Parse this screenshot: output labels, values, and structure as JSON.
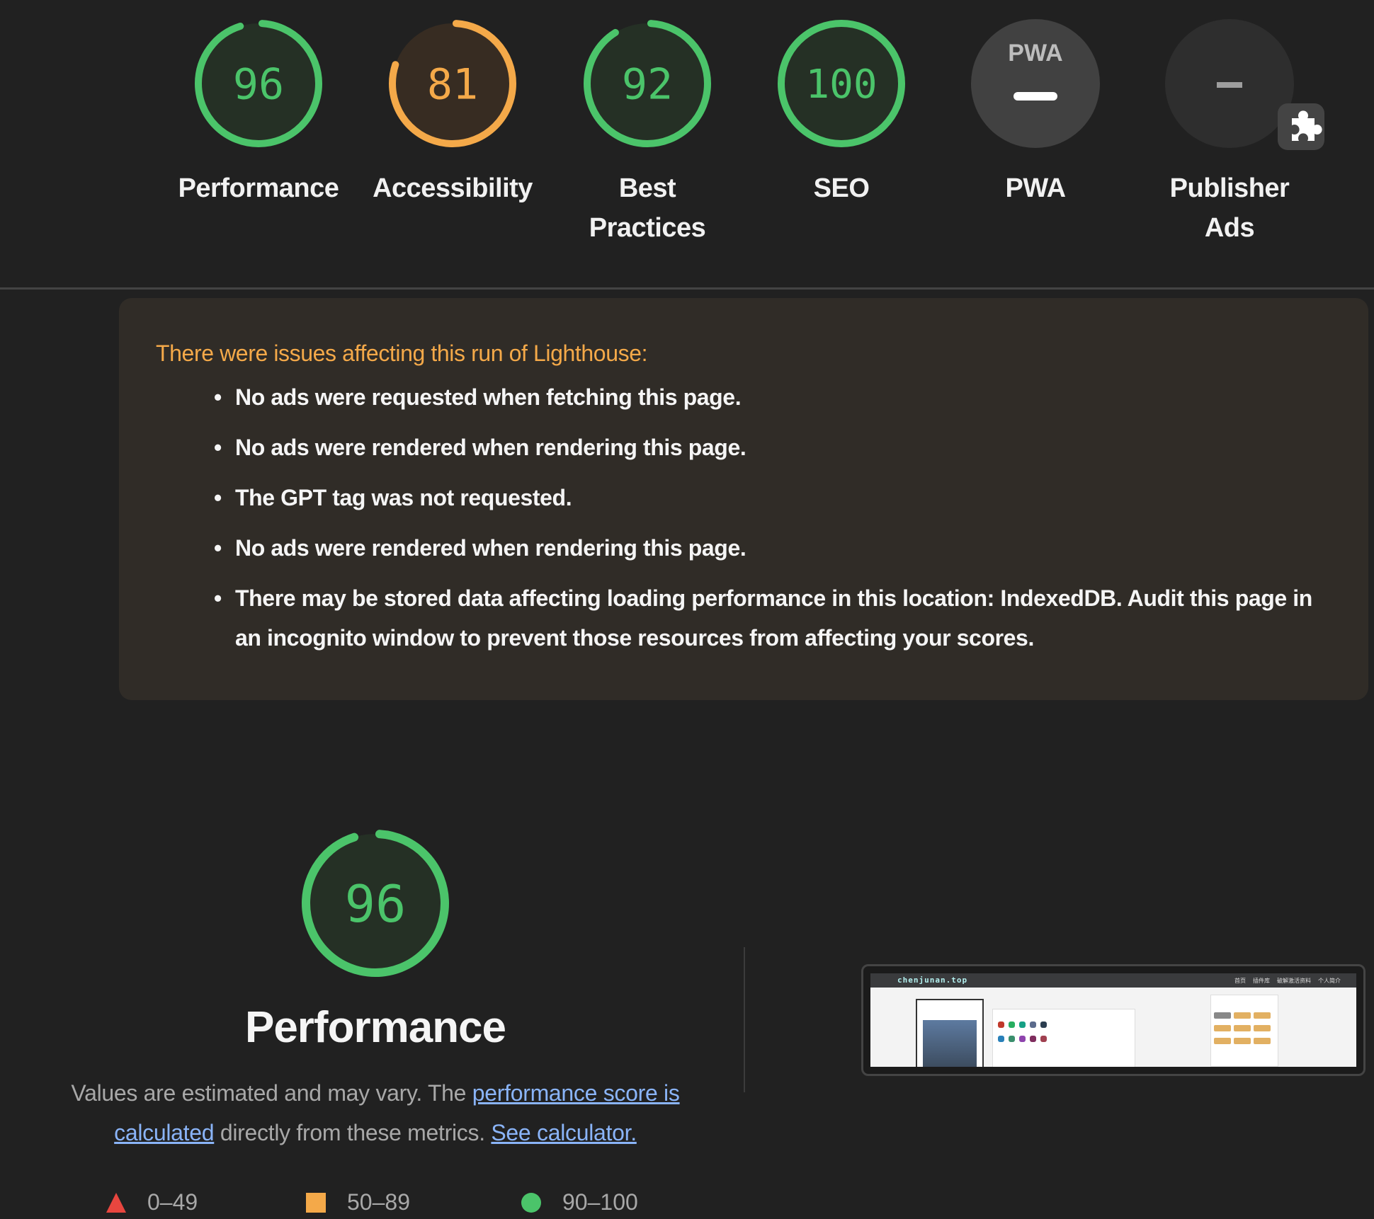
{
  "categories": [
    {
      "id": "performance",
      "score": "96",
      "label_lines": [
        "Performance"
      ],
      "type": "score",
      "color": "#4bc46a",
      "fill": "#253025",
      "fraction": 0.96
    },
    {
      "id": "accessibility",
      "score": "81",
      "label_lines": [
        "Accessibility"
      ],
      "type": "score",
      "color": "#f4a949",
      "fill": "#372c22",
      "fraction": 0.81
    },
    {
      "id": "best-practices",
      "score": "92",
      "label_lines": [
        "Best",
        "Practices"
      ],
      "type": "score",
      "color": "#4bc46a",
      "fill": "#253025",
      "fraction": 0.92
    },
    {
      "id": "seo",
      "score": "100",
      "label_lines": [
        "SEO"
      ],
      "type": "score",
      "color": "#4bc46a",
      "fill": "#253025",
      "fraction": 1.0
    },
    {
      "id": "pwa",
      "score": "–",
      "label_lines": [
        "PWA"
      ],
      "type": "pwa",
      "badge_text": "PWA"
    },
    {
      "id": "publisher-ads",
      "score": "–",
      "label_lines": [
        "Publisher",
        "Ads"
      ],
      "type": "plugin"
    }
  ],
  "warning": {
    "title": "There were issues affecting this run of Lighthouse:",
    "items": [
      "No ads were requested when fetching this page.",
      "No ads were rendered when rendering this page.",
      "The GPT tag was not requested.",
      "No ads were rendered when rendering this page.",
      "There may be stored data affecting loading performance in this location: IndexedDB. Audit this page in an incognito window to prevent those resources from affecting your scores."
    ]
  },
  "performance": {
    "score": "96",
    "fraction": 0.96,
    "title": "Performance",
    "desc_prefix": "Values are estimated and may vary. The ",
    "link1": "performance score is calculated",
    "desc_middle": " directly from these metrics. ",
    "link2": "See calculator."
  },
  "legend": [
    {
      "shape": "triangle",
      "label": "0–49",
      "color": "#e8463f"
    },
    {
      "shape": "square",
      "label": "50–89",
      "color": "#f4a949"
    },
    {
      "shape": "circle",
      "label": "90–100",
      "color": "#4bc46a"
    }
  ],
  "screenshot": {
    "site_name": "chenjunan.top",
    "nav": [
      "首页",
      "插件库",
      "破解激活资料",
      "个人简介"
    ]
  },
  "colors": {
    "pass": "#4bc46a",
    "average": "#f4a949",
    "fail": "#e8463f",
    "link": "#8ab4f8"
  }
}
